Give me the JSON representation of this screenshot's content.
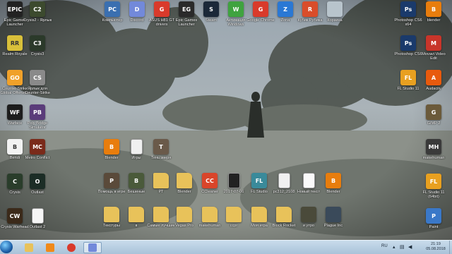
{
  "desktop": {
    "icons": [
      {
        "label": "Epic Games Launcher",
        "icon": "epic-games-icon",
        "color": "#222222",
        "text": "EPIC"
      },
      {
        "label": "Crysis2 - Ярлык",
        "icon": "crysis-icon",
        "color": "#3c4a2e",
        "text": "C2"
      },
      {
        "label": "Realm Royale",
        "icon": "realm-royale-icon",
        "color": "#d9c03a",
        "text": "RR"
      },
      {
        "label": "Crysis3",
        "icon": "crysis-icon",
        "color": "#2b3a2a",
        "text": "C3"
      },
      {
        "label": "Counter-Strike Global Offensive",
        "icon": "csgo-icon",
        "color": "#f0a12a",
        "text": "GO"
      },
      {
        "label": "Ярлык для Counter-Strike",
        "icon": "counter-strike-icon",
        "color": "#8a8a8a",
        "text": "CS"
      },
      {
        "label": "Warface",
        "icon": "warface-icon",
        "color": "#1d1d1d",
        "text": "WF"
      },
      {
        "label": "Poly Bridge Simulator",
        "icon": "poly-bridge-icon",
        "color": "#5a3c7a",
        "text": "PB"
      },
      {
        "label": "Bendi",
        "icon": "bendi-icon",
        "color": "#f2f2f2",
        "text": "B"
      },
      {
        "label": "Metro Conflict",
        "icon": "metro-conflict-icon",
        "color": "#7a2a1a",
        "text": "MC"
      },
      {
        "label": "Crysis",
        "icon": "crysis-icon",
        "color": "#2a3d2b",
        "text": "C"
      },
      {
        "label": "Outlast",
        "icon": "outlast-icon",
        "color": "#1c2d26",
        "text": "O"
      },
      {
        "label": "Crysis Warhead",
        "icon": "crysis-icon",
        "color": "#3b2a1a",
        "text": "CW"
      },
      {
        "label": "Outlast 2",
        "icon": "document-icon",
        "color": "#f5f5f5",
        "text": ""
      },
      {
        "label": "Компьютер",
        "icon": "computer-icon",
        "color": "#3a6fb0",
        "text": "PC"
      },
      {
        "label": "Discord",
        "icon": "discord-icon",
        "color": "#7289da",
        "text": "D"
      },
      {
        "label": "ASUS H81 GT drivers",
        "icon": "chrome-icon",
        "color": "#d93a2b",
        "text": "G"
      },
      {
        "label": "Epic Games Launcher",
        "icon": "epic-games-icon",
        "color": "#2a2a2a",
        "text": "EG"
      },
      {
        "label": "Steam",
        "icon": "steam-icon",
        "color": "#1b2838",
        "text": "S"
      },
      {
        "label": "Активация Windows",
        "icon": "activation-icon",
        "color": "#3fa33f",
        "text": "W"
      },
      {
        "label": "Google Chrome",
        "icon": "chrome-icon",
        "color": "#d93a2b",
        "text": "G"
      },
      {
        "label": "Zona",
        "icon": "zona-icon",
        "color": "#2a78d4",
        "text": "Z"
      },
      {
        "label": "Кубик Рубика",
        "icon": "rubiks-cube-icon",
        "color": "#d94d2a",
        "text": "R"
      },
      {
        "label": "Корзина",
        "icon": "recycle-bin-icon",
        "color": "#b8c4cc",
        "text": ""
      },
      {
        "label": "Photoshop CS6 x64",
        "icon": "photoshop-icon",
        "color": "#1a3a6b",
        "text": "Ps"
      },
      {
        "label": "blender",
        "icon": "blender-icon",
        "color": "#e87d0d",
        "text": "B"
      },
      {
        "label": "Photoshop CS6",
        "icon": "photoshop-icon",
        "color": "#1a3a6b",
        "text": "Ps"
      },
      {
        "label": "Movavi Video Edit",
        "icon": "movavi-icon",
        "color": "#c8352a",
        "text": "M"
      },
      {
        "label": "FL Studio 11",
        "icon": "fl-studio-icon",
        "color": "#e8a020",
        "text": "FL"
      },
      {
        "label": "Audacity",
        "icon": "audacity-icon",
        "color": "#e85a0d",
        "text": "A"
      },
      {
        "label": "GIMP 2",
        "icon": "gimp-icon",
        "color": "#6b5a3a",
        "text": "G"
      },
      {
        "label": "makehuman",
        "icon": "makehuman-icon",
        "color": "#3a3a3a",
        "text": "MH"
      },
      {
        "label": "FL Studio 11 (64bit)",
        "icon": "fl-studio-icon",
        "color": "#e8a020",
        "text": "FL"
      },
      {
        "label": "Paint",
        "icon": "paint-icon",
        "color": "#3a78c8",
        "text": "P"
      },
      {
        "label": "Blender",
        "icon": "blender-icon",
        "color": "#e87d0d",
        "text": "B"
      },
      {
        "label": "Игры",
        "icon": "document-icon",
        "color": "#f0f0f0",
        "text": ""
      },
      {
        "label": "Тень зверя",
        "icon": "shortcut-icon",
        "color": "#6a5a4a",
        "text": "T"
      },
      {
        "label": "Помощь в игре",
        "icon": "shortcut-icon",
        "color": "#5a4a3a",
        "text": "P"
      },
      {
        "label": "Бешеные",
        "icon": "shortcut-icon",
        "color": "#4a5a3a",
        "text": "B"
      },
      {
        "label": "РТ",
        "icon": "folder-icon",
        "color": "#e8c25a",
        "text": ""
      },
      {
        "label": "Blender",
        "icon": "folder-icon",
        "color": "#e8c25a",
        "text": ""
      },
      {
        "label": "CCleaner",
        "icon": "ccleaner-icon",
        "color": "#d9452a",
        "text": "CC"
      },
      {
        "label": "2017-07-06",
        "icon": "image-icon",
        "color": "#222222",
        "text": ""
      },
      {
        "label": "FL Studio",
        "icon": "fl-studio-icon",
        "color": "#3a8a9a",
        "text": "FL"
      },
      {
        "label": "pc312_2108",
        "icon": "document-icon",
        "color": "#f0f0f0",
        "text": ""
      },
      {
        "label": "Новый текст",
        "icon": "text-file-icon",
        "color": "#fafafa",
        "text": ""
      },
      {
        "label": "Blender",
        "icon": "blender-icon",
        "color": "#e87d0d",
        "text": "B"
      },
      {
        "label": "Текстуры",
        "icon": "folder-icon",
        "color": "#e8c25a",
        "text": ""
      },
      {
        "label": "в",
        "icon": "folder-icon",
        "color": "#e8c25a",
        "text": ""
      },
      {
        "label": "Самые лучшие",
        "icon": "folder-icon",
        "color": "#e8c25a",
        "text": ""
      },
      {
        "label": "Vegas Pro",
        "icon": "folder-icon",
        "color": "#e8c25a",
        "text": ""
      },
      {
        "label": "makehuman",
        "icon": "folder-icon",
        "color": "#e8c25a",
        "text": ""
      },
      {
        "label": "ccpr",
        "icon": "folder-icon",
        "color": "#e8c25a",
        "text": ""
      },
      {
        "label": "Моя игра",
        "icon": "folder-icon",
        "color": "#e8c25a",
        "text": ""
      },
      {
        "label": "Block Rocket",
        "icon": "folder-icon",
        "color": "#e8c25a",
        "text": ""
      },
      {
        "label": "и утро",
        "icon": "shortcut-icon",
        "color": "#4a4a3a",
        "text": ""
      },
      {
        "label": "Plague Inc",
        "icon": "shortcut-icon",
        "color": "#3a4a5a",
        "text": ""
      }
    ]
  },
  "taskbar": {
    "buttons": [
      {
        "name": "explorer-icon",
        "color": "#e8c25a"
      },
      {
        "name": "media-player-icon",
        "color": "#f08a1a"
      },
      {
        "name": "chrome-icon",
        "color": "#d93a2b"
      },
      {
        "name": "discord-icon",
        "color": "#7289da"
      }
    ],
    "language": "RU",
    "time": "21:19",
    "date": "05.08.2018"
  }
}
